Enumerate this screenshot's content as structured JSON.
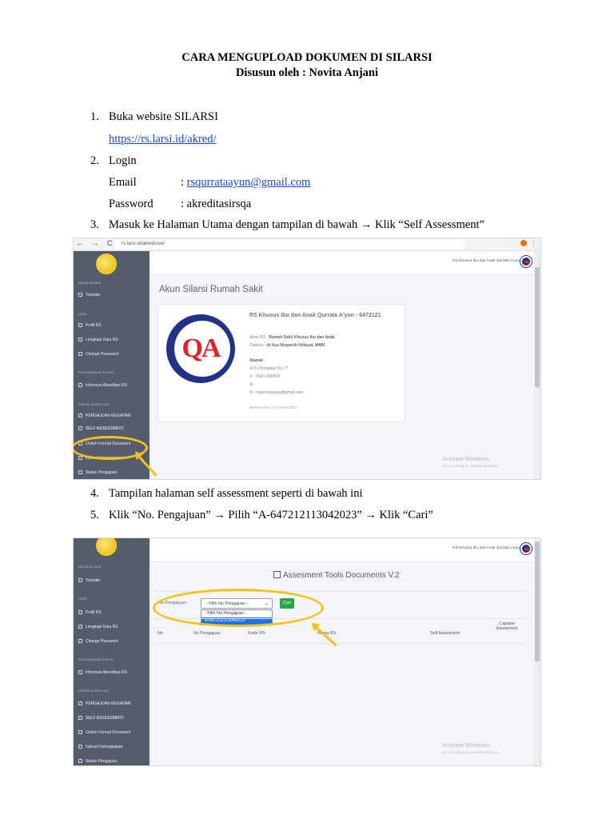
{
  "doc": {
    "title": "CARA MENGUPLOAD DOKUMEN DI SILARSI",
    "subtitle": "Disusun oleh : Novita Anjani",
    "step1_num": "1.",
    "step1": "Buka website SILARSI",
    "step1_link": "https://rs.larsi.id/akred/",
    "step2_num": "2.",
    "step2": "Login",
    "email_label": "Email",
    "email_sep": ": ",
    "email_value": "rsqurrataayun@gmail.com",
    "password_label": "Password",
    "password_value": ": akreditasirsqa",
    "step3_num": "3.",
    "step3": "Masuk ke Halaman Utama dengan tampilan di bawah → Klik “Self Assessment”",
    "step4_num": "4.",
    "step4": "Tampilan halaman self assessment seperti di bawah ini",
    "step5_num": "5.",
    "step5": "Klik “No. Pengajuan” → Pilih “A-647212113042023” → Klik “Cari”"
  },
  "browser": {
    "nav": "← → C",
    "url": "rs.larsi.id/akred/user",
    "buttons": "⋮"
  },
  "sidebar": {
    "head_media": "MEDIA SILARSI",
    "youtube": "Youtube",
    "head_user": "USER",
    "profil": "Profil RS",
    "lengkapi": "Lengkapi Data RS",
    "change_pw": "Change Password",
    "head_pelaksanaan": "PELAKSANAAN SURVEI",
    "informasi": "Informasi Akreditasi RS",
    "head_survei": "SURVEI AKREDITASI",
    "pengajuan": "PENGAJUAN KEGIATAN",
    "self_assessment": "SELF ASSESSMENT",
    "unduh": "Unduh Format Document",
    "upload": "Upload Kelengkapan",
    "status": "Status Pengajuan"
  },
  "topbar": {
    "hospital": "RS Khusus Ibu dan Anak Qurrata A'yun"
  },
  "account": {
    "heading": "Akun Silarsi Rumah Sakit",
    "logo_text": "QA",
    "rs_name": "RS Khusus Ibu dan Anak Qurrata A'yun - 6472121",
    "jenis_label": "Jenis RS : ",
    "jenis_value": "Rumah Sakit Khusus Ibu dan Anak",
    "direktur_label": "Direktur : ",
    "direktur_value": "dr Asa Muqarrib Hidayat, MMR",
    "alamat_label": "Alamat :",
    "alamat_value": "Jl D.I.Panjaitan No.77",
    "phone": ": 0541-282818",
    "web": ":",
    "email": ": rsqurrataayun@gmail.com",
    "member_since": "Member since 27 October 2022"
  },
  "watermark": {
    "title": "Activate Windows",
    "sub": "Go to Settings to activate Windows."
  },
  "assessment": {
    "heading": "Assesment Tools Documents V.2",
    "no_pengajuan_label": "No Pengajuan :",
    "select_value": "- Pilih No Pengajuan -",
    "options": [
      "- Pilih No Pengajuan -",
      "A-647212113042023"
    ],
    "cari_button": "Cari",
    "columns": {
      "no": "No",
      "no_pengajuan": "No Pengajuan",
      "kode_rs": "Kode RS",
      "nama_rs": "Nama RS",
      "self_assessment": "Self Assesment",
      "capaian": "Capaian Assesment"
    }
  }
}
